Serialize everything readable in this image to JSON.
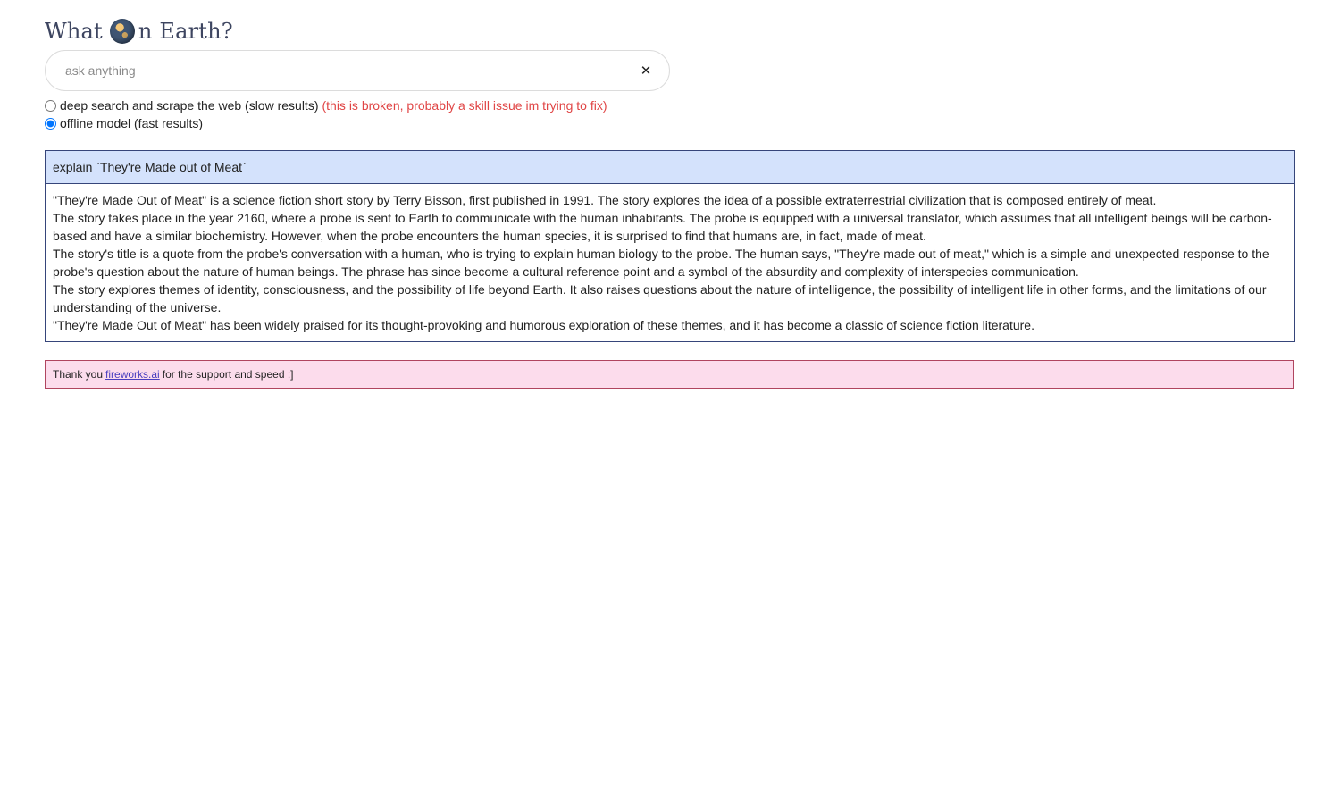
{
  "app": {
    "title_part1": "What",
    "title_part2": "n Earth?",
    "logo_icon": "globe-icon"
  },
  "search": {
    "placeholder": "ask anything",
    "value": "",
    "clear_label": "✕"
  },
  "options": {
    "deep": {
      "label": "deep search and scrape the web (slow results)",
      "warning": "(this is broken, probably a skill issue im trying to fix)",
      "checked": false
    },
    "offline": {
      "label": "offline model (fast results)",
      "checked": true
    }
  },
  "qa": {
    "question": "explain `They're Made out of Meat`",
    "answer": [
      "\"They're Made Out of Meat\" is a science fiction short story by Terry Bisson, first published in 1991. The story explores the idea of a possible extraterrestrial civilization that is composed entirely of meat.",
      "The story takes place in the year 2160, where a probe is sent to Earth to communicate with the human inhabitants. The probe is equipped with a universal translator, which assumes that all intelligent beings will be carbon-based and have a similar biochemistry. However, when the probe encounters the human species, it is surprised to find that humans are, in fact, made of meat.",
      "The story's title is a quote from the probe's conversation with a human, who is trying to explain human biology to the probe. The human says, \"They're made out of meat,\" which is a simple and unexpected response to the probe's question about the nature of human beings. The phrase has since become a cultural reference point and a symbol of the absurdity and complexity of interspecies communication.",
      "The story explores themes of identity, consciousness, and the possibility of life beyond Earth. It also raises questions about the nature of intelligence, the possibility of intelligent life in other forms, and the limitations of our understanding of the universe.",
      "\"They're Made Out of Meat\" has been widely praised for its thought-provoking and humorous exploration of these themes, and it has become a classic of science fiction literature."
    ]
  },
  "footer": {
    "text_before": "Thank you",
    "link": "fireworks.ai",
    "text_after": "for the support and speed :]"
  },
  "colors": {
    "question_bg": "#d4e2fc",
    "panel_border": "#36457a",
    "footer_bg": "#fcdcec",
    "footer_border": "#b0455f",
    "warning": "#e04545",
    "link": "#4a3fbf"
  }
}
